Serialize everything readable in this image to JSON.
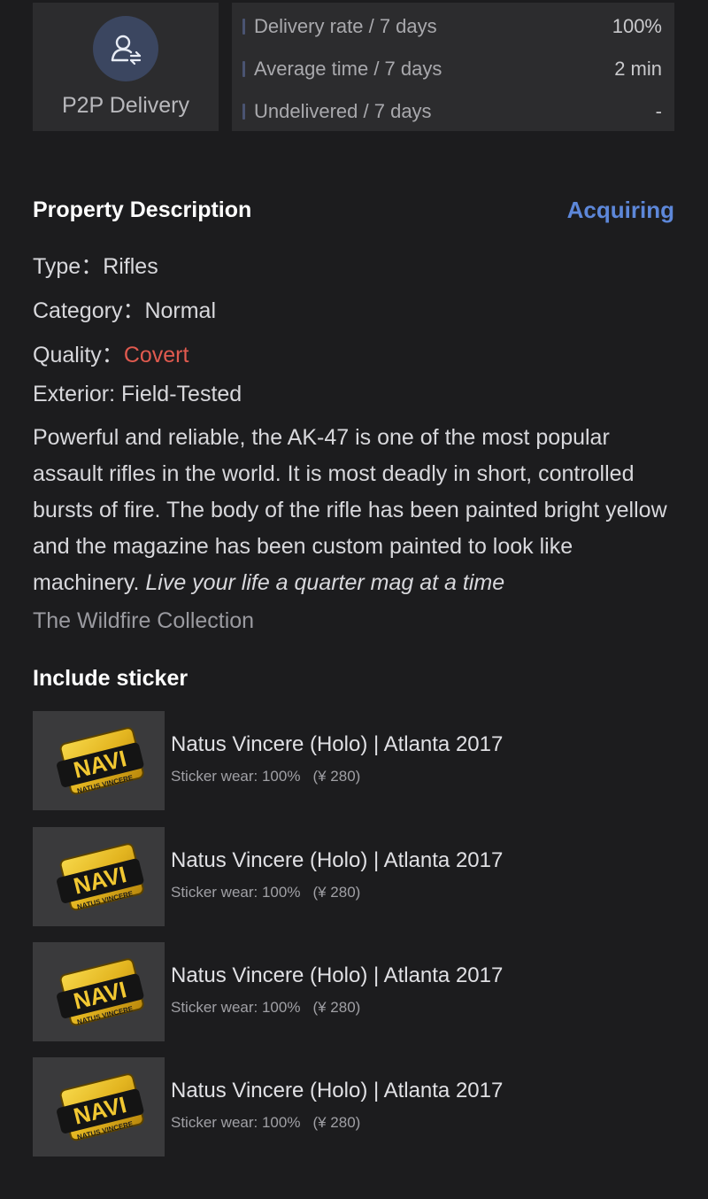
{
  "delivery": {
    "label": "P2P Delivery",
    "icon": "user-transfer-icon",
    "stats": [
      {
        "label": "Delivery rate / 7 days",
        "value": "100%"
      },
      {
        "label": "Average time / 7 days",
        "value": "2 min"
      },
      {
        "label": "Undelivered / 7 days",
        "value": "-"
      }
    ]
  },
  "property": {
    "title": "Property Description",
    "acquiring": "Acquiring",
    "type_label": "Type：",
    "type_value": "Rifles",
    "category_label": "Category：",
    "category_value": "Normal",
    "quality_label": "Quality：",
    "quality_value": "Covert",
    "exterior": "Exterior: Field-Tested",
    "description": "Powerful and reliable, the AK-47 is one of the most popular assault rifles in the world. It is most deadly in short, controlled bursts of fire. The body of the rifle has been painted bright yellow and the magazine has been custom painted to look like machinery.",
    "quote": "Live your life a quarter mag at a time",
    "collection": "The Wildfire Collection"
  },
  "stickers": {
    "title": "Include sticker",
    "items": [
      {
        "name": "Natus Vincere (Holo) | Atlanta 2017",
        "wear": "Sticker wear: 100%",
        "price": "(¥ 280)",
        "logo_text": "NAVI",
        "sub_text": "NATUS VINCERE"
      },
      {
        "name": "Natus Vincere (Holo) | Atlanta 2017",
        "wear": "Sticker wear: 100%",
        "price": "(¥ 280)",
        "logo_text": "NAVI",
        "sub_text": "NATUS VINCERE"
      },
      {
        "name": "Natus Vincere (Holo) | Atlanta 2017",
        "wear": "Sticker wear: 100%",
        "price": "(¥ 280)",
        "logo_text": "NAVI",
        "sub_text": "NATUS VINCERE"
      },
      {
        "name": "Natus Vincere (Holo) | Atlanta 2017",
        "wear": "Sticker wear: 100%",
        "price": "(¥ 280)",
        "logo_text": "NAVI",
        "sub_text": "NATUS VINCERE"
      }
    ]
  },
  "colors": {
    "background": "#1c1c1e",
    "card": "#2c2c2e",
    "accent_blue": "#5d87d9",
    "covert_red": "#e05a4f",
    "sticker_gold": "#e3b520"
  }
}
